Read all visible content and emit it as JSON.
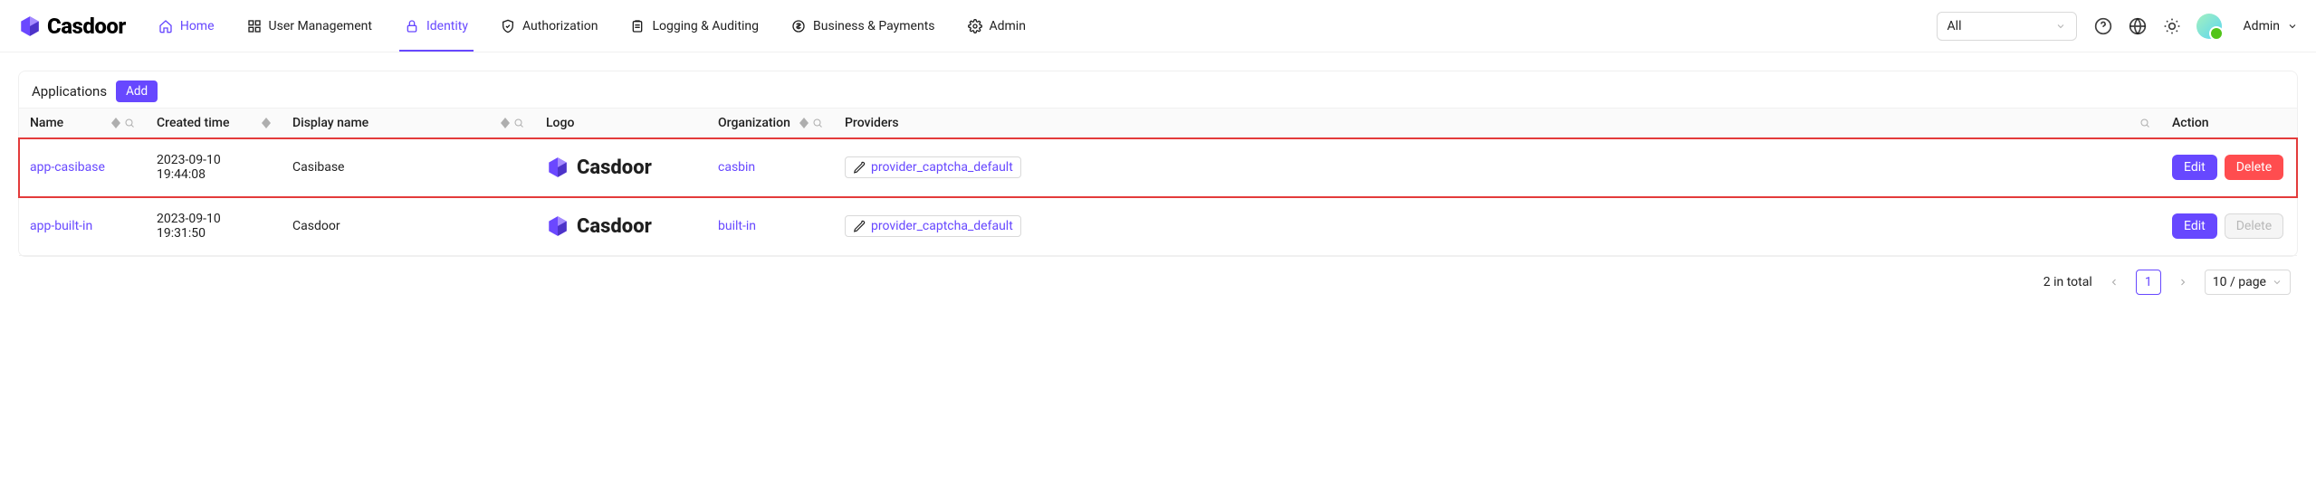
{
  "brand": "Casdoor",
  "nav": {
    "home": "Home",
    "userManagement": "User Management",
    "identity": "Identity",
    "authorization": "Authorization",
    "logging": "Logging & Auditing",
    "business": "Business & Payments",
    "admin": "Admin"
  },
  "orgSelect": {
    "value": "All"
  },
  "user": {
    "name": "Admin"
  },
  "card": {
    "title": "Applications",
    "addLabel": "Add"
  },
  "columns": {
    "name": "Name",
    "created": "Created time",
    "display": "Display name",
    "logo": "Logo",
    "org": "Organization",
    "providers": "Providers",
    "action": "Action"
  },
  "actions": {
    "edit": "Edit",
    "delete": "Delete"
  },
  "rows": [
    {
      "name": "app-casibase",
      "created": "2023-09-10 19:44:08",
      "display": "Casibase",
      "logoText": "Casdoor",
      "org": "casbin",
      "provider": "provider_captcha_default",
      "deletable": true,
      "highlight": true
    },
    {
      "name": "app-built-in",
      "created": "2023-09-10 19:31:50",
      "display": "Casdoor",
      "logoText": "Casdoor",
      "org": "built-in",
      "provider": "provider_captcha_default",
      "deletable": false,
      "highlight": false
    }
  ],
  "pagination": {
    "totalText": "2 in total",
    "current": "1",
    "pageSize": "10 / page"
  },
  "colors": {
    "primary": "#6748ff",
    "danger": "#ff4d4f"
  }
}
